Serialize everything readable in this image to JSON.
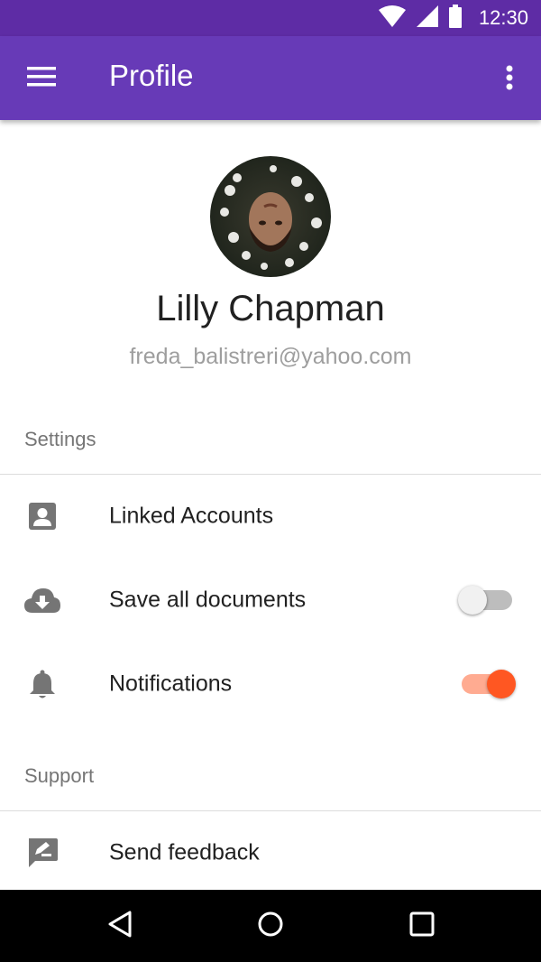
{
  "status_bar": {
    "time": "12:30",
    "icons": [
      "wifi-icon",
      "signal-icon",
      "battery-icon"
    ]
  },
  "app_bar": {
    "title": "Profile",
    "left_icon": "menu-icon",
    "right_icon": "more-vert-icon"
  },
  "profile": {
    "name": "Lilly Chapman",
    "email": "freda_balistreri@yahoo.com",
    "avatar": "avatar-photo"
  },
  "settings": {
    "header": "Settings",
    "items": [
      {
        "label": "Linked Accounts",
        "icon": "account-box-icon"
      },
      {
        "label": "Save all documents",
        "icon": "cloud-download-icon",
        "toggle": false
      },
      {
        "label": "Notifications",
        "icon": "bell-icon",
        "toggle": true
      }
    ]
  },
  "support": {
    "header": "Support",
    "items": [
      {
        "label": "Send feedback",
        "icon": "feedback-icon"
      }
    ]
  },
  "nav_bar": {
    "icons": [
      "back-icon",
      "home-icon",
      "recents-icon"
    ]
  },
  "colors": {
    "status_bar": "#5e2ca5",
    "app_bar": "#673ab7",
    "accent": "#ff5722",
    "accent_track": "#ffab91",
    "text_primary": "#212121",
    "text_secondary": "#9e9e9e"
  }
}
